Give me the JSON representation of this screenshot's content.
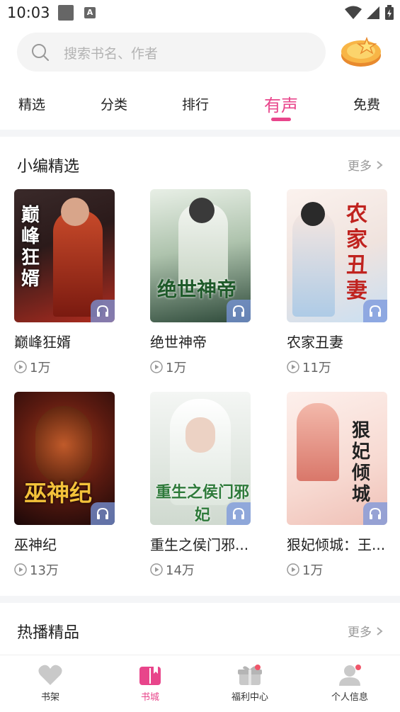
{
  "status": {
    "time": "10:03"
  },
  "search": {
    "placeholder": "搜索书名、作者"
  },
  "tabs": [
    "精选",
    "分类",
    "排行",
    "有声",
    "免费"
  ],
  "section1": {
    "title": "小编精选",
    "more": "更多"
  },
  "section2": {
    "title": "热播精品",
    "more": "更多"
  },
  "books": [
    {
      "title": "巅峰狂婿",
      "plays": "1万",
      "cover_text": "巅峰狂婿",
      "colors": [
        "#2b1a1a",
        "#b22c1f"
      ]
    },
    {
      "title": "绝世神帝",
      "plays": "1万",
      "cover_text": "绝世神帝",
      "colors": [
        "#d9e6d8",
        "#2e4a3a"
      ]
    },
    {
      "title": "农家丑妻",
      "plays": "11万",
      "cover_text": "农家丑妻",
      "colors": [
        "#f6e9e4",
        "#c9dff2"
      ]
    },
    {
      "title": "巫神纪",
      "plays": "13万",
      "cover_text": "巫神纪",
      "colors": [
        "#3a1010",
        "#8a2a12"
      ]
    },
    {
      "title": "重生之侯门邪...",
      "plays": "14万",
      "cover_text": "重生之侯门邪妃",
      "colors": [
        "#eaf0ea",
        "#cfd9cf"
      ]
    },
    {
      "title": "狠妃倾城：王...",
      "plays": "1万",
      "cover_text": "狠妃倾城",
      "colors": [
        "#fbe7e2",
        "#f2c9c1"
      ]
    }
  ],
  "nav": [
    {
      "label": "书架",
      "active": false
    },
    {
      "label": "书城",
      "active": true
    },
    {
      "label": "福利中心",
      "active": false
    },
    {
      "label": "个人信息",
      "active": false
    }
  ],
  "colors": {
    "accent": "#e8458b",
    "badge": "#f0566a",
    "muted": "#999999"
  }
}
